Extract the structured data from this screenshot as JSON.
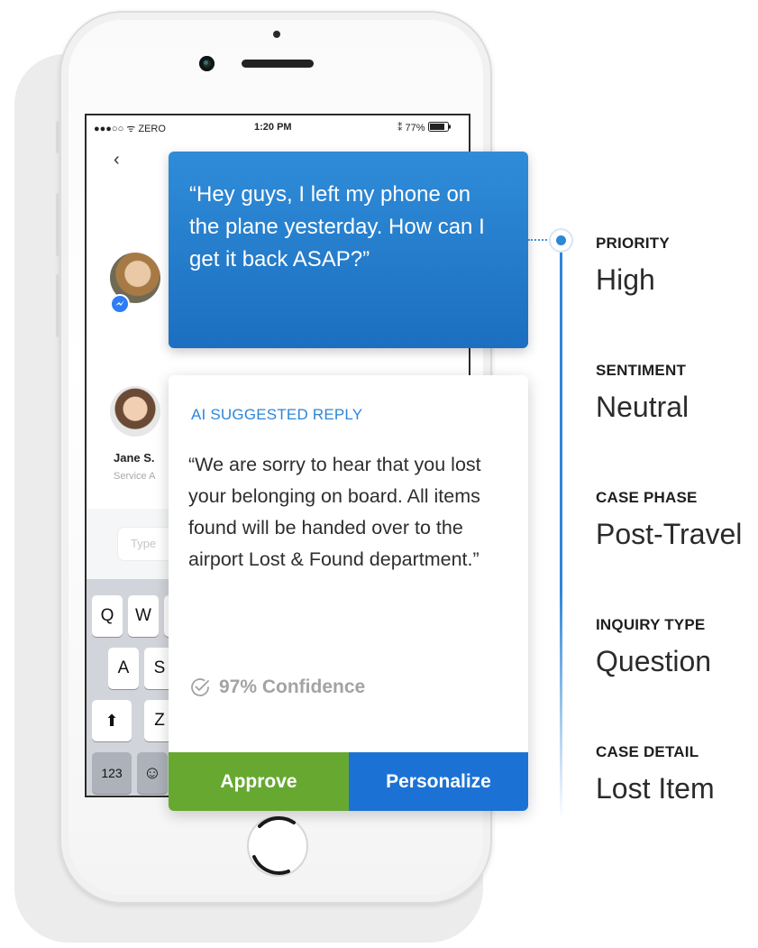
{
  "status_bar": {
    "carrier": "●●●○○ ᯤ ZERO",
    "time": "1:20 PM",
    "battery": "⁑ 77%"
  },
  "chat": {
    "back_icon": "chevron-left-icon",
    "agent_name": "Jane S.",
    "agent_role": "Service A",
    "compose_placeholder": "Type"
  },
  "keyboard": {
    "row1": [
      "Q",
      "W"
    ],
    "row2": [
      "A",
      "S"
    ],
    "row3_shift": "⬆",
    "row3": [
      "Z"
    ],
    "row4_numbers": "123",
    "row4_emoji": "☺"
  },
  "customer_message": "“Hey guys, I left my phone on the plane yesterday. How can I get it back ASAP?”",
  "reply_card": {
    "heading": "AI SUGGESTED REPLY",
    "text": "“We are sorry to hear that you lost your belonging on board. All items found will be handed over to the airport Lost & Found department.”",
    "confidence": "97% Confidence",
    "approve_label": "Approve",
    "personalize_label": "Personalize"
  },
  "attributes": [
    {
      "label": "PRIORITY",
      "value": "High"
    },
    {
      "label": "SENTIMENT",
      "value": "Neutral"
    },
    {
      "label": "CASE PHASE",
      "value": "Post-Travel"
    },
    {
      "label": "INQUIRY TYPE",
      "value": "Question"
    },
    {
      "label": "CASE DETAIL",
      "value": "Lost Item"
    }
  ],
  "colors": {
    "message_blue": "#1c6fc0",
    "reply_heading_blue": "#2b86d9",
    "approve_green": "#67a831",
    "personalize_blue": "#1c72d4",
    "timeline_blue": "#2d86d8"
  }
}
